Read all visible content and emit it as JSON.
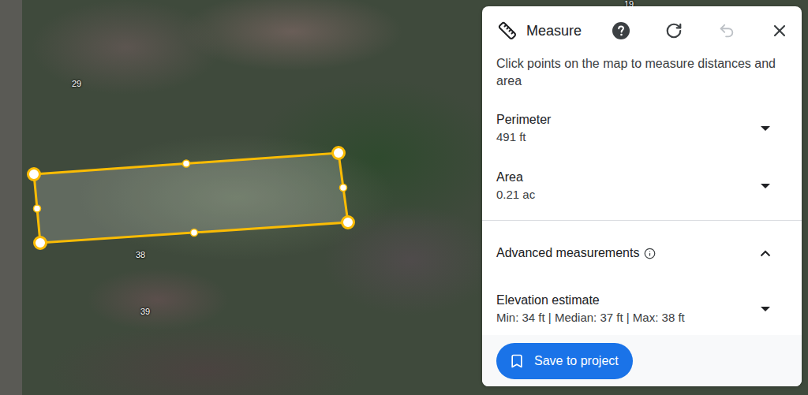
{
  "map": {
    "labels": [
      {
        "text": "29"
      },
      {
        "text": "38"
      },
      {
        "text": "39"
      },
      {
        "text": "19"
      }
    ]
  },
  "panel": {
    "title": "Measure",
    "tools": [
      {
        "kind": "help",
        "disabled": false
      },
      {
        "kind": "refresh",
        "disabled": false
      },
      {
        "kind": "undo",
        "disabled": true
      },
      {
        "kind": "close",
        "disabled": false
      }
    ],
    "description": "Click points on the map to measure distances and area",
    "metrics": [
      {
        "label": "Perimeter",
        "value": "491 ft",
        "expanded": false
      },
      {
        "label": "Area",
        "value": "0.21 ac",
        "expanded": false
      }
    ],
    "advanced": {
      "label": "Advanced measurements",
      "expanded": true
    },
    "elevation": {
      "label": "Elevation estimate",
      "value": "Min: 34 ft | Median: 37 ft | Max: 38 ft",
      "expanded": false
    },
    "save_button": "Save to project"
  }
}
